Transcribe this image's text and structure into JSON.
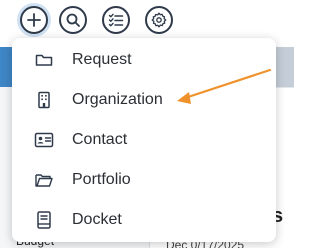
{
  "toolbar": {
    "buttons": [
      {
        "icon": "plus-icon",
        "active": true
      },
      {
        "icon": "search-icon",
        "active": false
      },
      {
        "icon": "checklist-icon",
        "active": false
      },
      {
        "icon": "gear-icon",
        "active": false
      }
    ]
  },
  "menu": {
    "items": [
      {
        "label": "Request",
        "icon": "folder-icon"
      },
      {
        "label": "Organization",
        "icon": "building-icon"
      },
      {
        "label": "Contact",
        "icon": "contact-card-icon"
      },
      {
        "label": "Portfolio",
        "icon": "portfolio-icon"
      },
      {
        "label": "Docket",
        "icon": "docket-icon"
      }
    ]
  },
  "background": {
    "left_text": "Budget",
    "right_letter": "s",
    "right_text": "Dec 0/17/2025"
  },
  "colors": {
    "accent_blue": "#3f86c6",
    "arrow_orange": "#f0922b",
    "icon_dark": "#2f3a4a"
  }
}
